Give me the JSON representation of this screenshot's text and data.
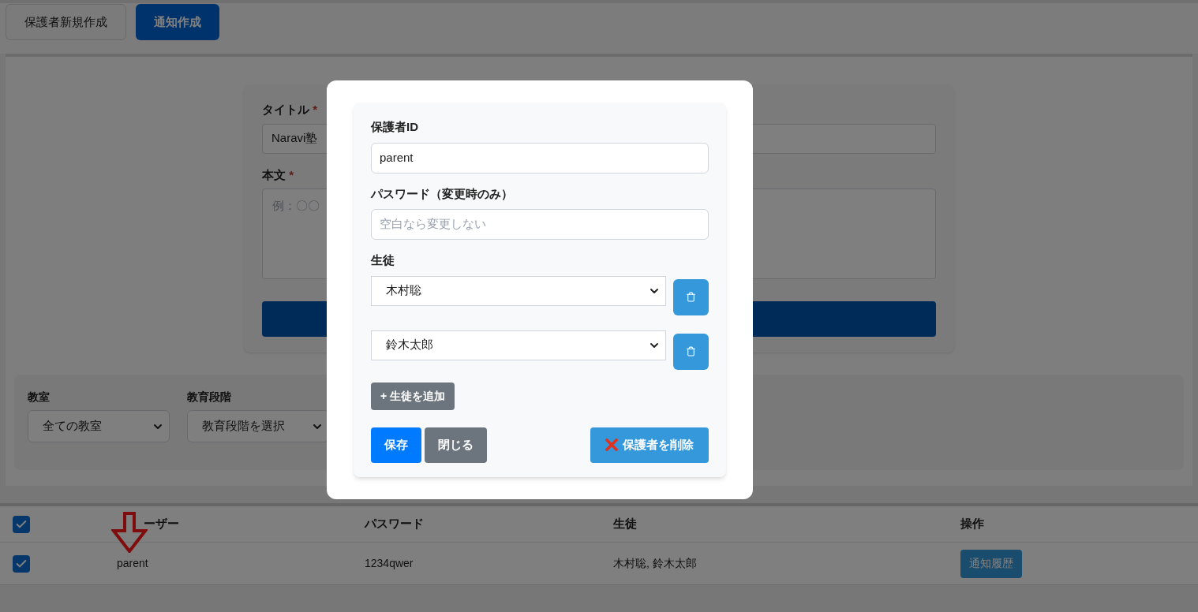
{
  "top_buttons": [
    {
      "label": "保護者新規作成",
      "selected": false
    },
    {
      "label": "通知作成",
      "selected": true
    }
  ],
  "notice_form": {
    "title_label": "タイトル",
    "title_required": "*",
    "title_value": "Naravi塾",
    "body_label": "本文",
    "body_required": "*",
    "body_placeholder": "例：〇〇"
  },
  "filters": [
    {
      "label": "教室",
      "value": "全ての教室"
    },
    {
      "label": "教育段階",
      "value": "教育段階を選択"
    }
  ],
  "table": {
    "select_all_checked": true,
    "columns": [
      "ーザー",
      "パスワード",
      "生徒",
      "操作"
    ],
    "rows": [
      {
        "checked": true,
        "user": "parent",
        "password": "1234qwer",
        "students": "木村聡, 鈴木太郎",
        "action": "通知履歴"
      }
    ]
  },
  "modal": {
    "id_label": "保護者ID",
    "id_value": "parent",
    "password_label": "パスワード（変更時のみ）",
    "password_placeholder": "空白なら変更しない",
    "students_label": "生徒",
    "students": [
      "木村聡",
      "鈴木太郎"
    ],
    "add_button": "+ 生徒を追加",
    "save_button": "保存",
    "close_button": "閉じる",
    "delete_button": "保護者を削除"
  }
}
